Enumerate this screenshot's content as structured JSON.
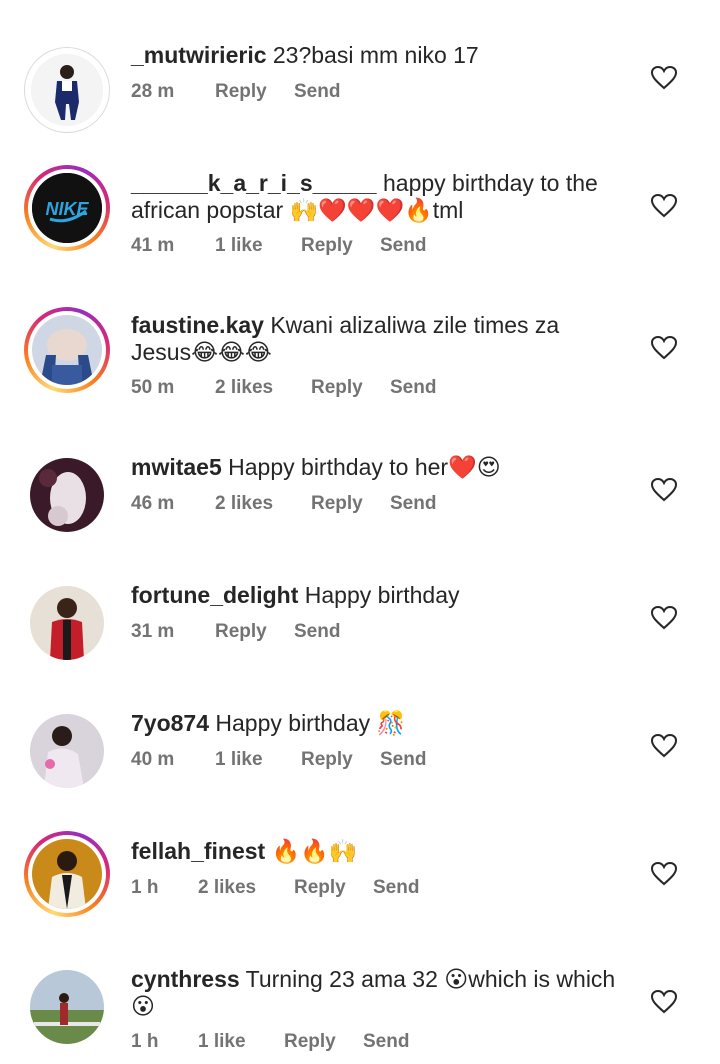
{
  "comments": [
    {
      "username": "_mutwirieric",
      "text": "23?basi mm niko 17",
      "time": "28 m",
      "likes": "",
      "reply": "Reply",
      "send": "Send"
    },
    {
      "username": "______k_a_r_i_s_____",
      "text": "happy birthday to the",
      "text2": "african popstar 🙌❤️❤️❤️🔥tml",
      "time": "41 m",
      "likes": "1 like",
      "reply": "Reply",
      "send": "Send"
    },
    {
      "username": "faustine.kay",
      "text": "Kwani alizaliwa zile times za",
      "text2": "Jesus😂😂😂",
      "time": "50 m",
      "likes": "2 likes",
      "reply": "Reply",
      "send": "Send"
    },
    {
      "username": "mwitae5",
      "text": "Happy birthday to her❤️😍",
      "time": "46 m",
      "likes": "2 likes",
      "reply": "Reply",
      "send": "Send"
    },
    {
      "username": "fortune_delight",
      "text": "Happy birthday",
      "time": "31 m",
      "likes": "",
      "reply": "Reply",
      "send": "Send"
    },
    {
      "username": "7yo874",
      "text": "Happy birthday 🎊",
      "time": "40 m",
      "likes": "1 like",
      "reply": "Reply",
      "send": "Send"
    },
    {
      "username": "fellah_finest",
      "text": "🔥🔥🙌",
      "time": "1 h",
      "likes": "2 likes",
      "reply": "Reply",
      "send": "Send"
    },
    {
      "username": "cynthress",
      "text": "Turning 23 ama 32 😮which is which",
      "text2": "😮",
      "time": "1 h",
      "likes": "1 like",
      "reply": "Reply",
      "send": "Send"
    }
  ],
  "avatar_logo_text": "NIKE"
}
